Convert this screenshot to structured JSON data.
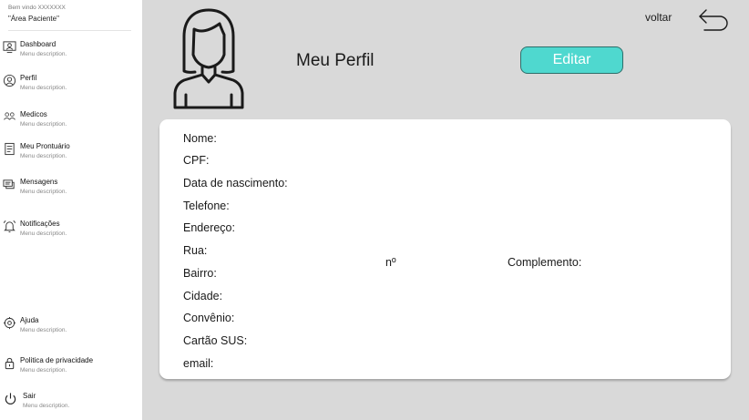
{
  "sidebar": {
    "welcome": "Bem vindo XXXXXXX",
    "area": "\"Área Paciente\"",
    "items": [
      {
        "label": "Dashboard",
        "description": "Menu description.",
        "icon": "dashboard-icon"
      },
      {
        "label": "Perfil",
        "description": "Menu description.",
        "icon": "profile-icon"
      },
      {
        "label": "Medicos",
        "description": "Menu description.",
        "icon": "doctors-icon"
      },
      {
        "label": "Meu Prontuário",
        "description": "Menu description.",
        "icon": "medical-record-icon"
      },
      {
        "label": "Mensagens",
        "description": "Menu description.",
        "icon": "messages-icon"
      },
      {
        "label": "Notificações",
        "description": "Menu description.",
        "icon": "notifications-icon"
      },
      {
        "label": "Ajuda",
        "description": "Menu description.",
        "icon": "help-icon"
      },
      {
        "label": "Politica de privacidade",
        "description": "Menu description.",
        "icon": "lock-icon"
      },
      {
        "label": "Sair",
        "description": "Menu description.",
        "icon": "power-icon"
      }
    ]
  },
  "header": {
    "title": "Meu Perfil",
    "edit_label": "Editar",
    "back_label": "voltar"
  },
  "profile": {
    "fields": [
      "Nome:",
      "CPF:",
      "Data de nascimento:",
      "Telefone:",
      "Endereço:",
      "Rua:",
      "Bairro:",
      "Cidade:",
      "Convênio:",
      "Cartão SUS:",
      "email:"
    ],
    "number_label": "nº",
    "complement_label": "Complemento:"
  },
  "colors": {
    "accent": "#4fd8cf",
    "background": "#d9d9d9",
    "card": "#ffffff"
  }
}
